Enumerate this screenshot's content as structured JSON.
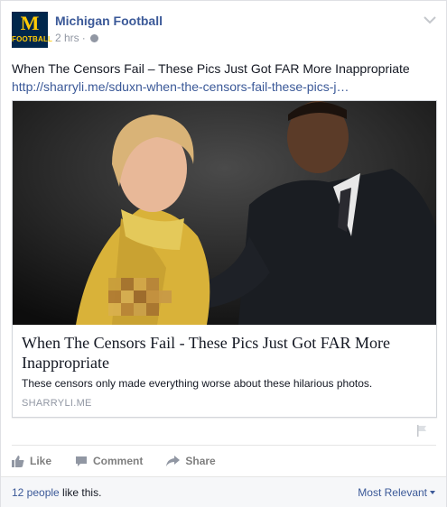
{
  "post": {
    "page_name": "Michigan Football",
    "time": "2 hrs",
    "separator": "·",
    "avatar": {
      "letter": "M",
      "word": "FOOTBALL",
      "bg": "#00274c",
      "fg": "#ffcb05"
    },
    "text": "When The Censors Fail – These Pics Just Got FAR More Inappropriate",
    "link": "http://sharryli.me/sduxn-when-the-censors-fail-these-pics-j…",
    "menu_icon": "chevron-down-icon",
    "privacy_icon": "globe-icon"
  },
  "card": {
    "title": "When The Censors Fail - These Pics Just Got FAR More Inappropriate",
    "description": "These censors only made everything worse about these hilarious photos.",
    "domain": "SHARRYLI.ME"
  },
  "actions": {
    "like": "Like",
    "comment": "Comment",
    "share": "Share"
  },
  "footer": {
    "likes_people": "12 people",
    "likes_suffix": " like this.",
    "sort_label": "Most Relevant"
  },
  "colors": {
    "link": "#3b5998",
    "muted": "#9197a3"
  }
}
